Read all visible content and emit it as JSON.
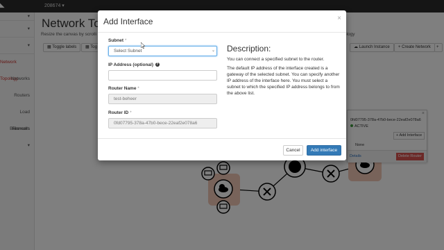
{
  "topbar": {
    "project": "208674 ▾"
  },
  "sidebar": {
    "items": [
      {
        "label": "▾"
      },
      {
        "label": "▾"
      },
      {
        "label": "▾"
      },
      {
        "label": "Network Topology"
      },
      {
        "label": "Networks"
      },
      {
        "label": "Routers"
      },
      {
        "label": "Load Balancers"
      },
      {
        "label": "Firewalls"
      },
      {
        "label": "▾"
      }
    ]
  },
  "main": {
    "title": "Network To",
    "subtitle": "Resize the canvas by scrolli",
    "subtitle_right": "ology",
    "toolbar": {
      "toggle_labels": "Toggle labels",
      "toggle_other": "Tog",
      "launch_instance": "Launch Instance",
      "create_network": "+ Create Network",
      "plus": "+"
    }
  },
  "router_popup": {
    "router_id": "0fd07795-378a-47b0-bece-22eaf2e078a6",
    "status": "ACTIVE",
    "add_interface": "Add Interface",
    "none": "None",
    "details": "Details",
    "delete_router": "Delete Router",
    "close": "×"
  },
  "modal": {
    "title": "Add Interface",
    "close": "×",
    "subnet_label": "Subnet",
    "subnet_required": "*",
    "subnet_value": "Select Subnet",
    "ip_label": "IP Address (optional)",
    "ip_value": "",
    "router_name_label": "Router Name",
    "router_name_required": "*",
    "router_name_value": "test-beheer",
    "router_id_label": "Router ID",
    "router_id_required": "*",
    "router_id_value": "0fd07795-378a-47b0-bece-22eaf2e078a6",
    "description_title": "Description:",
    "description_p1": "You can connect a specified subnet to the router.",
    "description_p2": "The default IP address of the interface created is a gateway of the selected subnet. You can specify another IP address of the interface here. You must select a subnet to which the specified IP address belongs to from the above list.",
    "cancel": "Cancel",
    "add_interface": "Add interface"
  },
  "colors": {
    "primary": "#337ab7",
    "danger": "#d9534f",
    "active_nav": "#c9302c",
    "active_status": "#3c9b3c"
  }
}
